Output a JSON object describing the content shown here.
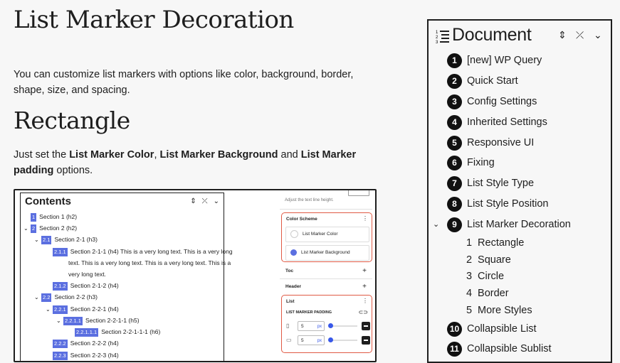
{
  "headings": {
    "main": "List Marker Decoration",
    "rectangle": "Rectangle"
  },
  "paragraphs": {
    "intro": "You can customize list markers with options like color, background, border, shape, size, and spacing.",
    "rect_pre": "Just set the ",
    "rect_b1": "List Marker Color",
    "rect_comma": ", ",
    "rect_b2": "List Marker Background",
    "rect_and": " and ",
    "rect_b3": "List Marker padding",
    "rect_post": " options."
  },
  "screenshot": {
    "toc": {
      "title": "Contents",
      "rows": [
        {
          "num": "1",
          "text": "Section 1 (h2)"
        },
        {
          "num": "2",
          "text": "Section 2 (h2)"
        },
        {
          "num": "2.1",
          "text": "Section 2-1 (h3)"
        },
        {
          "num": "2.1.1",
          "text": "Section 2-1-1 (h4) This is a very long text. This is a very long"
        },
        {
          "num": "",
          "text": "text. This is a very long text. This is a very long text. This is a"
        },
        {
          "num": "",
          "text": "very long text."
        },
        {
          "num": "2.1.2",
          "text": "Section 2-1-2 (h4)"
        },
        {
          "num": "2.2",
          "text": "Section 2-2 (h3)"
        },
        {
          "num": "2.2.1",
          "text": "Section 2-2-1 (h4)"
        },
        {
          "num": "2.2.1.1",
          "text": "Section 2-2-1-1 (h5)"
        },
        {
          "num": "2.2.1.1.1",
          "text": "Section 2-2-1-1-1 (h6)"
        },
        {
          "num": "2.2.2",
          "text": "Section 2-2-2 (h4)"
        },
        {
          "num": "2.2.3",
          "text": "Section 2-2-3 (h4)"
        }
      ]
    },
    "settings": {
      "hint": "Adjust the text line height.",
      "color_scheme": "Color Scheme",
      "marker_color": "List Marker Color",
      "marker_background": "List Marker Background",
      "toc": "Toc",
      "header": "Header",
      "list": "List",
      "padding_label": "LIST MARKER PADDING",
      "pad_value_1": "5",
      "pad_value_2": "5",
      "pad_unit": "px",
      "pad_level": 0.05
    }
  },
  "document": {
    "title": "Document",
    "items": [
      {
        "num": "1",
        "label": "[new] WP Query"
      },
      {
        "num": "2",
        "label": "Quick Start"
      },
      {
        "num": "3",
        "label": "Config Settings"
      },
      {
        "num": "4",
        "label": "Inherited Settings"
      },
      {
        "num": "5",
        "label": "Responsive UI"
      },
      {
        "num": "6",
        "label": "Fixing"
      },
      {
        "num": "7",
        "label": "List Style Type"
      },
      {
        "num": "8",
        "label": "List Style Position"
      },
      {
        "num": "9",
        "label": "List Marker Decoration"
      }
    ],
    "subitems": [
      {
        "num": "1",
        "label": "Rectangle"
      },
      {
        "num": "2",
        "label": "Square"
      },
      {
        "num": "3",
        "label": "Circle"
      },
      {
        "num": "4",
        "label": "Border"
      },
      {
        "num": "5",
        "label": "More Styles"
      }
    ],
    "items_after": [
      {
        "num": "10",
        "label": "Collapsible List"
      },
      {
        "num": "11",
        "label": "Collapsible Sublist"
      }
    ]
  },
  "colors": {
    "accent": "#5b6fe0",
    "highlight_border": "#e05a45",
    "background_swatch": "#5b6fe0"
  },
  "icons": [
    "list-icon",
    "sort-icon",
    "collapse-icon",
    "chevron-down-icon",
    "plus-icon",
    "link-icon"
  ]
}
